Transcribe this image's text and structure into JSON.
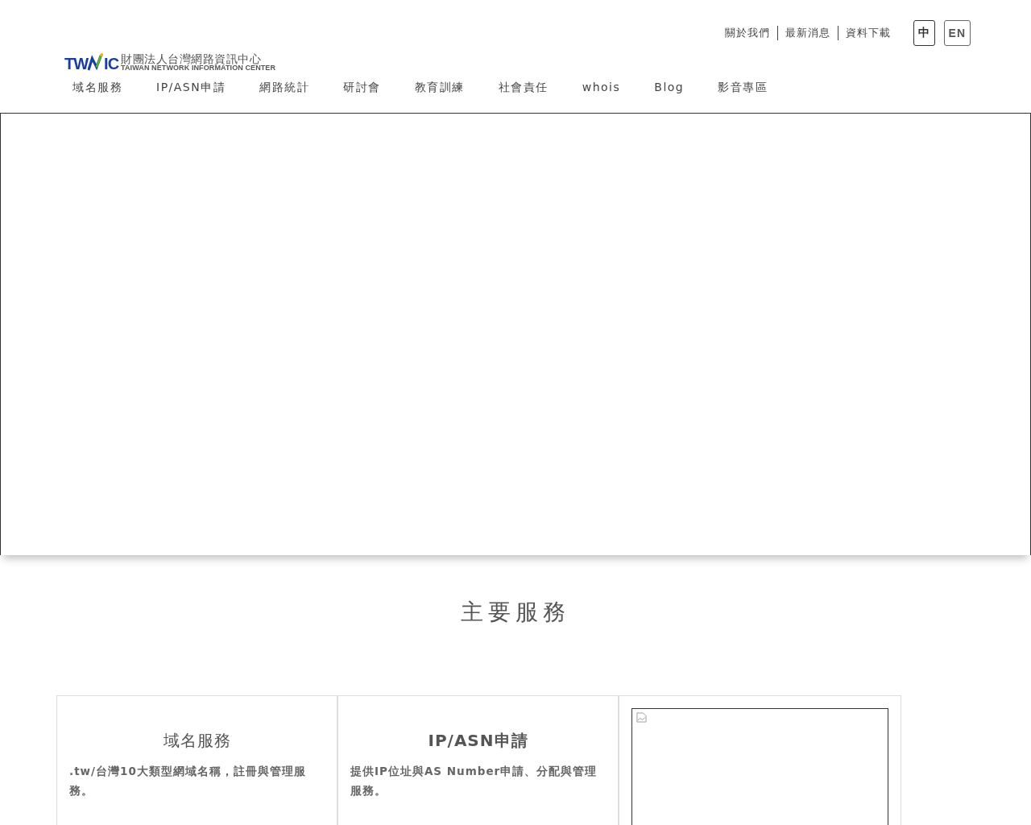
{
  "header": {
    "logo": {
      "mark_left": "TW",
      "mark_right": "IC",
      "name_zh": "財團法人台灣網路資訊中心",
      "name_en": "TAIWAN NETWORK INFORMATION CENTER"
    },
    "top_links": [
      "關於我們",
      "最新消息",
      "資料下載"
    ],
    "languages": [
      {
        "label": "中",
        "selected": true
      },
      {
        "label": "EN",
        "selected": false
      }
    ],
    "nav": [
      "域名服務",
      "IP/ASN申請",
      "網路統計",
      "研討會",
      "教育訓練",
      "社會責任",
      "whois",
      "Blog",
      "影音專區"
    ]
  },
  "hero": {
    "kind": "empty"
  },
  "services": {
    "title": "主要服務",
    "cards": [
      {
        "kind": "text",
        "title": "域名服務",
        "title_bold": false,
        "description": ".tw/台灣10大類型網域名稱，註冊與管理服務。"
      },
      {
        "kind": "text",
        "title": "IP/ASN申請",
        "title_bold": true,
        "description": "提供IP位址與AS Number申請、分配與管理服務。"
      },
      {
        "kind": "image"
      }
    ]
  }
}
